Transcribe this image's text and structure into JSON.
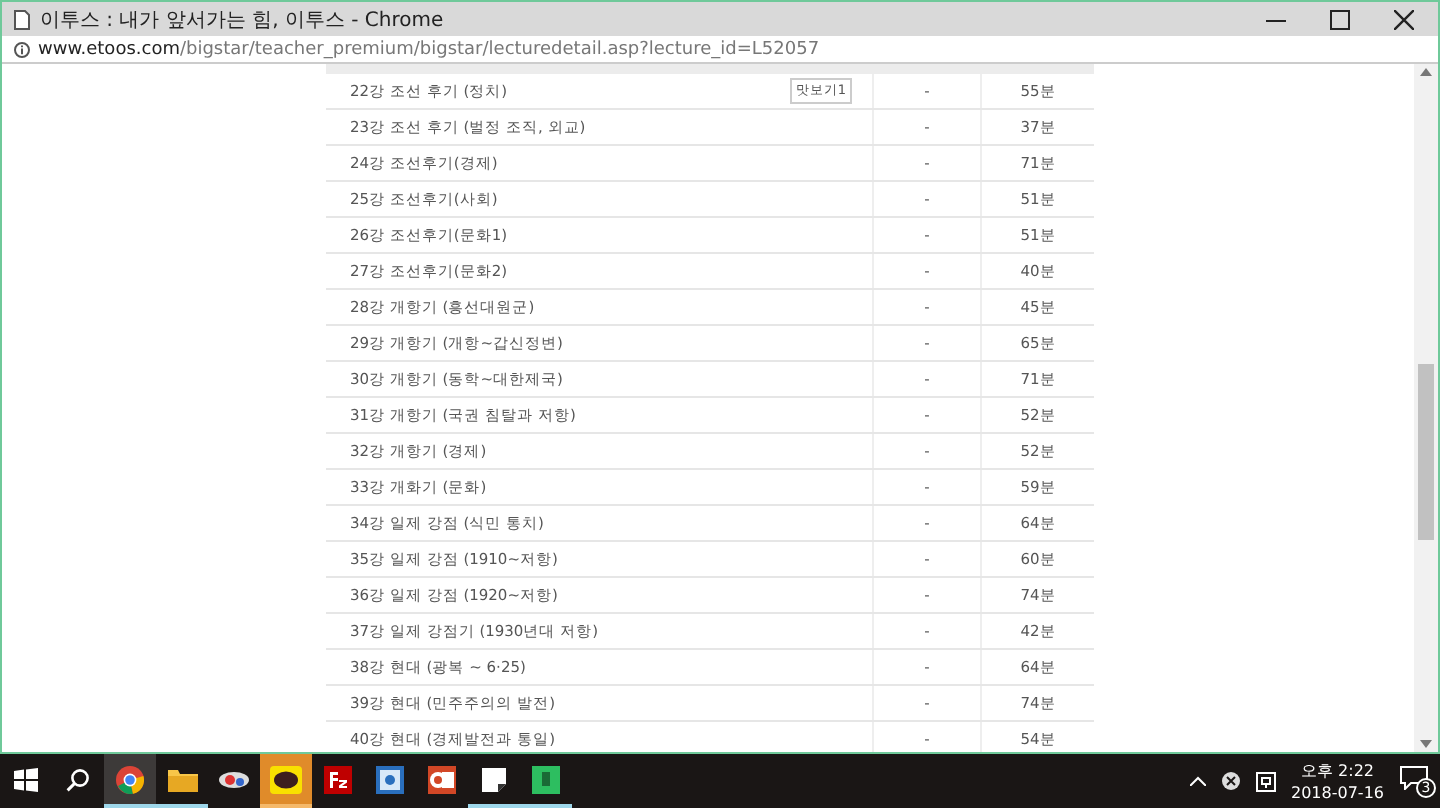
{
  "window": {
    "title": "이투스 : 내가 앞서가는 힘, 이투스 - Chrome"
  },
  "address": {
    "host": "www.etoos.com",
    "path": "/bigstar/teacher_premium/bigstar/lecturedetail.asp?lecture_id=L52057"
  },
  "lectures": [
    {
      "title": "22강 조선 후기 (정치)",
      "preview": "맛보기1",
      "column_2": "-",
      "duration": "55분"
    },
    {
      "title": "23강 조선 후기 (벌정 조직, 외교)",
      "column_2": "-",
      "duration": "37분"
    },
    {
      "title": "24강 조선후기(경제)",
      "column_2": "-",
      "duration": "71분"
    },
    {
      "title": "25강 조선후기(사회)",
      "column_2": "-",
      "duration": "51분"
    },
    {
      "title": "26강 조선후기(문화1)",
      "column_2": "-",
      "duration": "51분"
    },
    {
      "title": "27강 조선후기(문화2)",
      "column_2": "-",
      "duration": "40분"
    },
    {
      "title": "28강 개항기 (흥선대원군)",
      "column_2": "-",
      "duration": "45분"
    },
    {
      "title": "29강 개항기 (개항~갑신정변)",
      "column_2": "-",
      "duration": "65분"
    },
    {
      "title": "30강 개항기 (동학~대한제국)",
      "column_2": "-",
      "duration": "71분"
    },
    {
      "title": "31강 개항기 (국권 침탈과 저항)",
      "column_2": "-",
      "duration": "52분"
    },
    {
      "title": "32강 개항기 (경제)",
      "column_2": "-",
      "duration": "52분"
    },
    {
      "title": "33강 개화기 (문화)",
      "column_2": "-",
      "duration": "59분"
    },
    {
      "title": "34강 일제 강점 (식민 통치)",
      "column_2": "-",
      "duration": "64분"
    },
    {
      "title": "35강 일제 강점 (1910~저항)",
      "column_2": "-",
      "duration": "60분"
    },
    {
      "title": "36강 일제 강점 (1920~저항)",
      "column_2": "-",
      "duration": "74분"
    },
    {
      "title": "37강 일제 강점기 (1930년대 저항)",
      "column_2": "-",
      "duration": "42분"
    },
    {
      "title": "38강 현대 (광복 ~ 6·25)",
      "column_2": "-",
      "duration": "64분"
    },
    {
      "title": "39강 현대 (민주주의의 발전)",
      "column_2": "-",
      "duration": "74분"
    },
    {
      "title": "40강 현대 (경제발전과 통일)",
      "column_2": "-",
      "duration": "54분"
    }
  ],
  "taskbar": {
    "apps": [
      {
        "kind": "start",
        "selected": false,
        "running": false,
        "attention": false
      },
      {
        "kind": "search",
        "selected": false,
        "running": false,
        "attention": false
      },
      {
        "kind": "browser",
        "selected": true,
        "running": true,
        "attention": false
      },
      {
        "kind": "folder",
        "selected": false,
        "running": true,
        "attention": false
      },
      {
        "kind": "remote",
        "selected": false,
        "running": false,
        "attention": false
      },
      {
        "kind": "chat",
        "selected": false,
        "running": true,
        "attention": true
      },
      {
        "kind": "ftp",
        "selected": false,
        "running": false,
        "attention": false
      },
      {
        "kind": "viewer",
        "selected": false,
        "running": false,
        "attention": false
      },
      {
        "kind": "slides",
        "selected": false,
        "running": false,
        "attention": false
      },
      {
        "kind": "note",
        "selected": false,
        "running": true,
        "attention": false
      },
      {
        "kind": "notebook",
        "selected": false,
        "running": true,
        "attention": false
      }
    ],
    "time": "오후 2:22",
    "date": "2018-07-16",
    "notifications": "3"
  }
}
